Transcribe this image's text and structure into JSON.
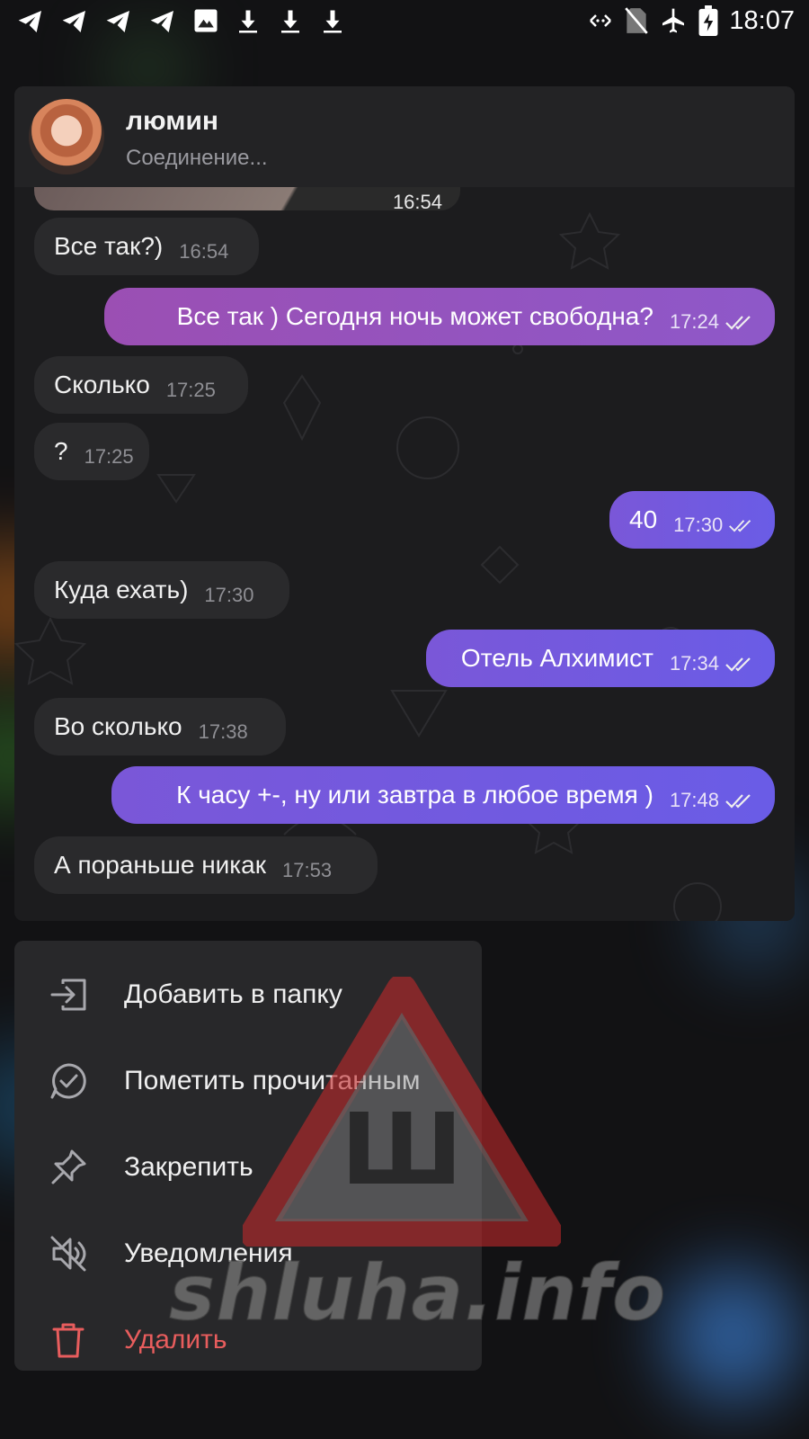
{
  "status_bar": {
    "time": "18:07",
    "left_icons": [
      "telegram-icon",
      "telegram-icon",
      "telegram-icon",
      "telegram-icon",
      "image-icon",
      "download-icon",
      "download-icon",
      "download-icon"
    ],
    "right_icons": [
      "data-transfer-icon",
      "no-sim-icon",
      "airplane-mode-icon",
      "battery-charging-icon"
    ]
  },
  "chat_header": {
    "name": "люмин",
    "status": "Соединение..."
  },
  "prev_photo_time": "16:54",
  "messages": [
    {
      "text": "Все так?)",
      "time": "16:54",
      "dir": "in"
    },
    {
      "text": "Все так ) Сегодня ночь может свободна?",
      "time": "17:24",
      "dir": "out"
    },
    {
      "text": "Сколько",
      "time": "17:25",
      "dir": "in"
    },
    {
      "text": "?",
      "time": "17:25",
      "dir": "in"
    },
    {
      "text": "40",
      "time": "17:30",
      "dir": "out"
    },
    {
      "text": "Куда ехать)",
      "time": "17:30",
      "dir": "in"
    },
    {
      "text": "Отель Алхимист",
      "time": "17:34",
      "dir": "out"
    },
    {
      "text": "Во сколько",
      "time": "17:38",
      "dir": "in"
    },
    {
      "text": "К часу +-, ну или завтра в любое время )",
      "time": "17:48",
      "dir": "out"
    },
    {
      "text": "А пораньше никак",
      "time": "17:53",
      "dir": "in"
    }
  ],
  "context_menu": {
    "items": [
      {
        "label": "Добавить в папку",
        "icon": "move-to-folder-icon"
      },
      {
        "label": "Пометить прочитанным",
        "icon": "mark-read-icon"
      },
      {
        "label": "Закрепить",
        "icon": "pin-icon"
      },
      {
        "label": "Уведомления",
        "icon": "mute-icon"
      },
      {
        "label": "Удалить",
        "icon": "trash-icon"
      }
    ]
  },
  "watermark": {
    "text": "shluha.info",
    "symbol": "Ш"
  },
  "colors": {
    "outgoing_bubble_top": "#9a52b8",
    "outgoing_bubble_bottom": "#6b5ae0",
    "incoming_bubble": "#2a2a2c",
    "danger": "#e85d5d"
  }
}
